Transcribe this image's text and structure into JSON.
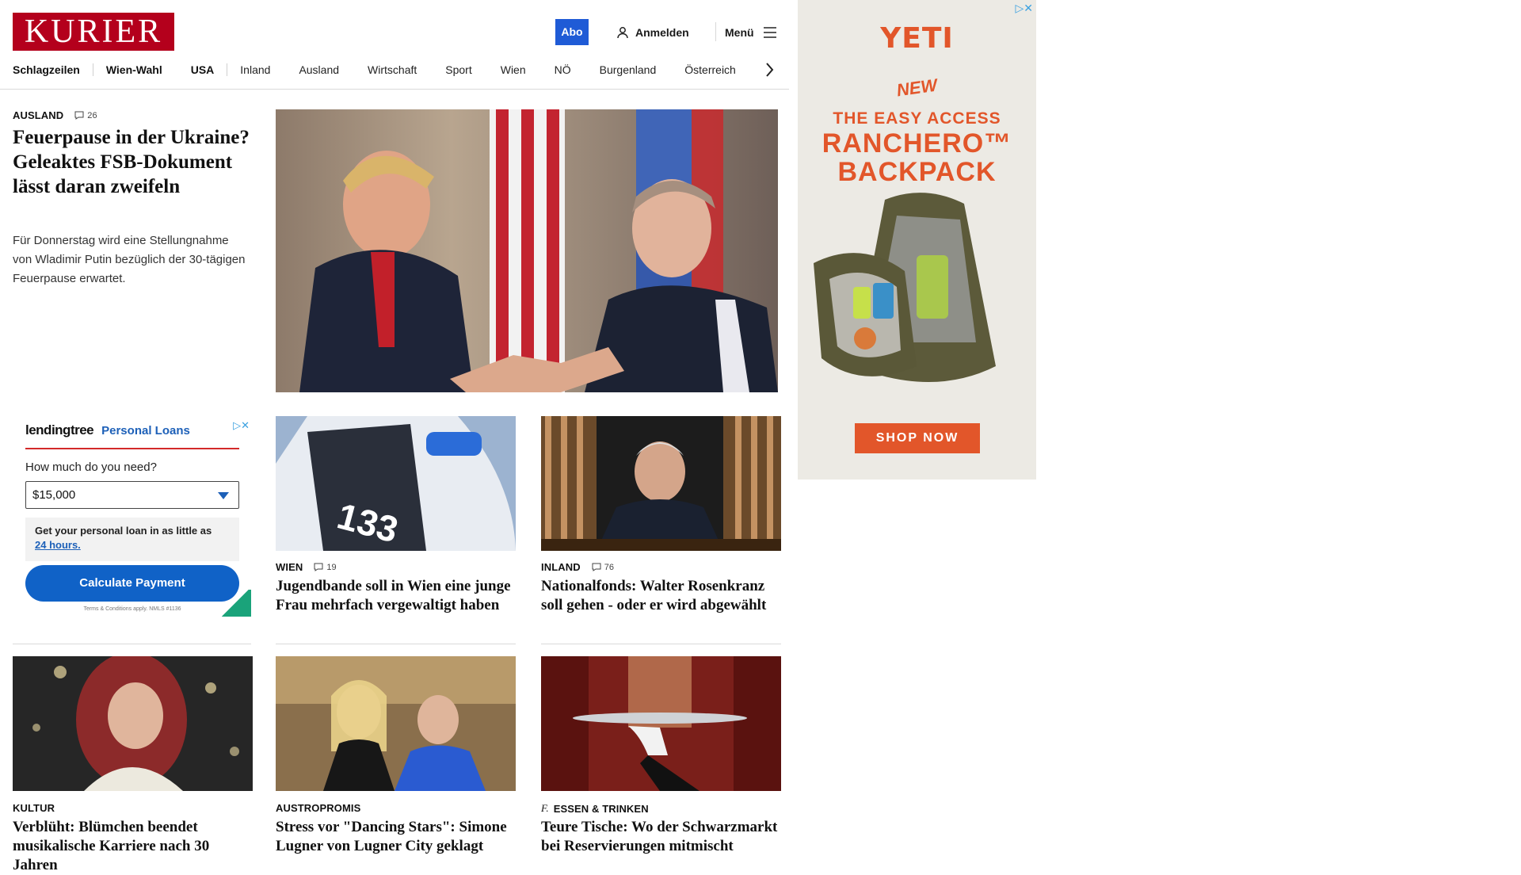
{
  "header": {
    "logo_text": "KURIER",
    "abo_label": "Abo",
    "login_label": "Anmelden",
    "menu_label": "Menü"
  },
  "nav": {
    "items": [
      "Schlagzeilen",
      "Wien-Wahl",
      "USA",
      "Inland",
      "Ausland",
      "Wirtschaft",
      "Sport",
      "Wien",
      "NÖ",
      "Burgenland",
      "Österreich"
    ]
  },
  "lead": {
    "kicker": "AUSLAND",
    "comments": "26",
    "title": "Feuerpause in der Ukraine? Geleaktes FSB-Dokument lässt daran zweifeln",
    "teaser": "Für Donnerstag wird eine Stellungnahme von Wladimir Putin bezüglich der 30-tägigen Feuerpause erwartet."
  },
  "ad_lendingtree": {
    "brand": "lendingtree",
    "product": "Personal Loans",
    "question": "How much do you need?",
    "amount": "$15,000",
    "info_text": "Get your personal loan in as little as",
    "info_link": "24 hours.",
    "cta": "Calculate Payment",
    "terms": "Terms & Conditions apply. NMLS #1136"
  },
  "cards": [
    {
      "kicker": "WIEN",
      "comments": "19",
      "title": "Jugendbande soll in Wien eine junge Frau mehrfach vergewaltigt haben"
    },
    {
      "kicker": "INLAND",
      "comments": "76",
      "title": "Nationalfonds: Walter Rosenkranz soll gehen - oder er wird abgewählt"
    },
    {
      "kicker": "KULTUR",
      "title": "Verblüht: Blümchen beendet musikalische Karriere nach 30 Jahren"
    },
    {
      "kicker": "AUSTROPROMIS",
      "title": "Stress vor \"Dancing Stars\": Simone Lugner von Lugner City geklagt"
    },
    {
      "kicker": "ESSEN & TRINKEN",
      "title": "Teure Tische: Wo der Schwarzmarkt bei Reservierungen mitmischt"
    }
  ],
  "ad_yeti": {
    "brand": "YETI",
    "badge": "NEW",
    "line1": "THE EASY ACCESS",
    "line2": "RANCHERO™",
    "line3": "BACKPACK",
    "cta": "SHOP NOW"
  },
  "colors": {
    "brand_red": "#b4001c",
    "abo_blue": "#1f5bd6",
    "yeti_orange": "#e2562a",
    "lendingtree_blue": "#1062c7"
  }
}
